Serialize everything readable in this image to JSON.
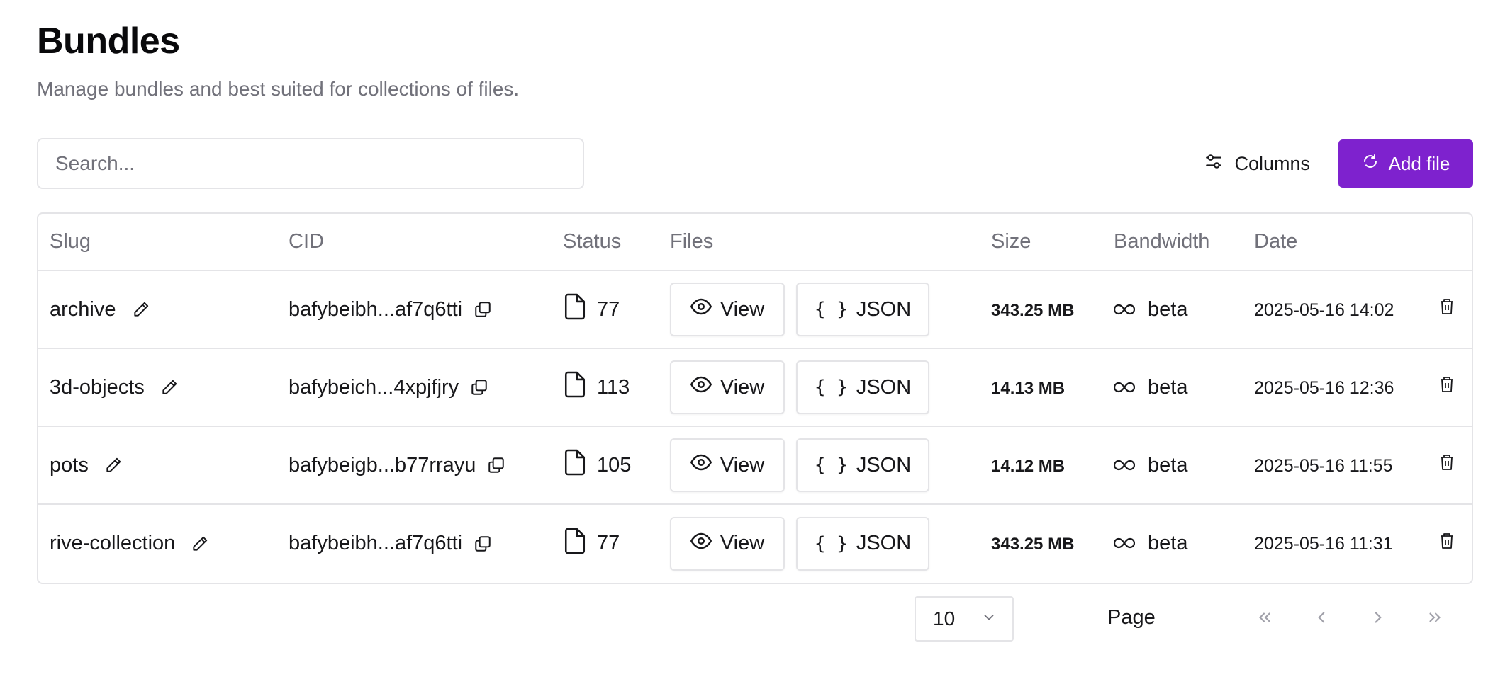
{
  "header": {
    "title": "Bundles",
    "subtitle": "Manage bundles and best suited for collections of files."
  },
  "toolbar": {
    "search_placeholder": "Search...",
    "columns_label": "Columns",
    "add_file_label": "Add file"
  },
  "table": {
    "columns": [
      "Slug",
      "CID",
      "Status",
      "Files",
      "Size",
      "Bandwidth",
      "Date"
    ],
    "view_label": "View",
    "json_label": "JSON",
    "json_icon_text": "{ }",
    "rows": [
      {
        "slug": "archive",
        "cid": "bafybeibh...af7q6tti",
        "status": "77",
        "size": "343.25 MB",
        "bandwidth": "beta",
        "date": "2025-05-16 14:02"
      },
      {
        "slug": "3d-objects",
        "cid": "bafybeich...4xpjfjry",
        "status": "113",
        "size": "14.13 MB",
        "bandwidth": "beta",
        "date": "2025-05-16 12:36"
      },
      {
        "slug": "pots",
        "cid": "bafybeigb...b77rrayu",
        "status": "105",
        "size": "14.12 MB",
        "bandwidth": "beta",
        "date": "2025-05-16 11:55"
      },
      {
        "slug": "rive-collection",
        "cid": "bafybeibh...af7q6tti",
        "status": "77",
        "size": "343.25 MB",
        "bandwidth": "beta",
        "date": "2025-05-16 11:31"
      }
    ]
  },
  "pagination": {
    "page_size": "10",
    "page_label": "Page"
  },
  "colors": {
    "accent": "#7e22ce",
    "border": "#e4e4e7",
    "muted_text": "#71717a"
  },
  "icons": {
    "edit": "pencil-icon",
    "copy": "copy-icon",
    "file": "file-icon",
    "view": "eye-icon",
    "bandwidth": "infinity-icon",
    "delete": "trash-icon",
    "columns": "sliders-icon",
    "add": "refresh-icon"
  }
}
